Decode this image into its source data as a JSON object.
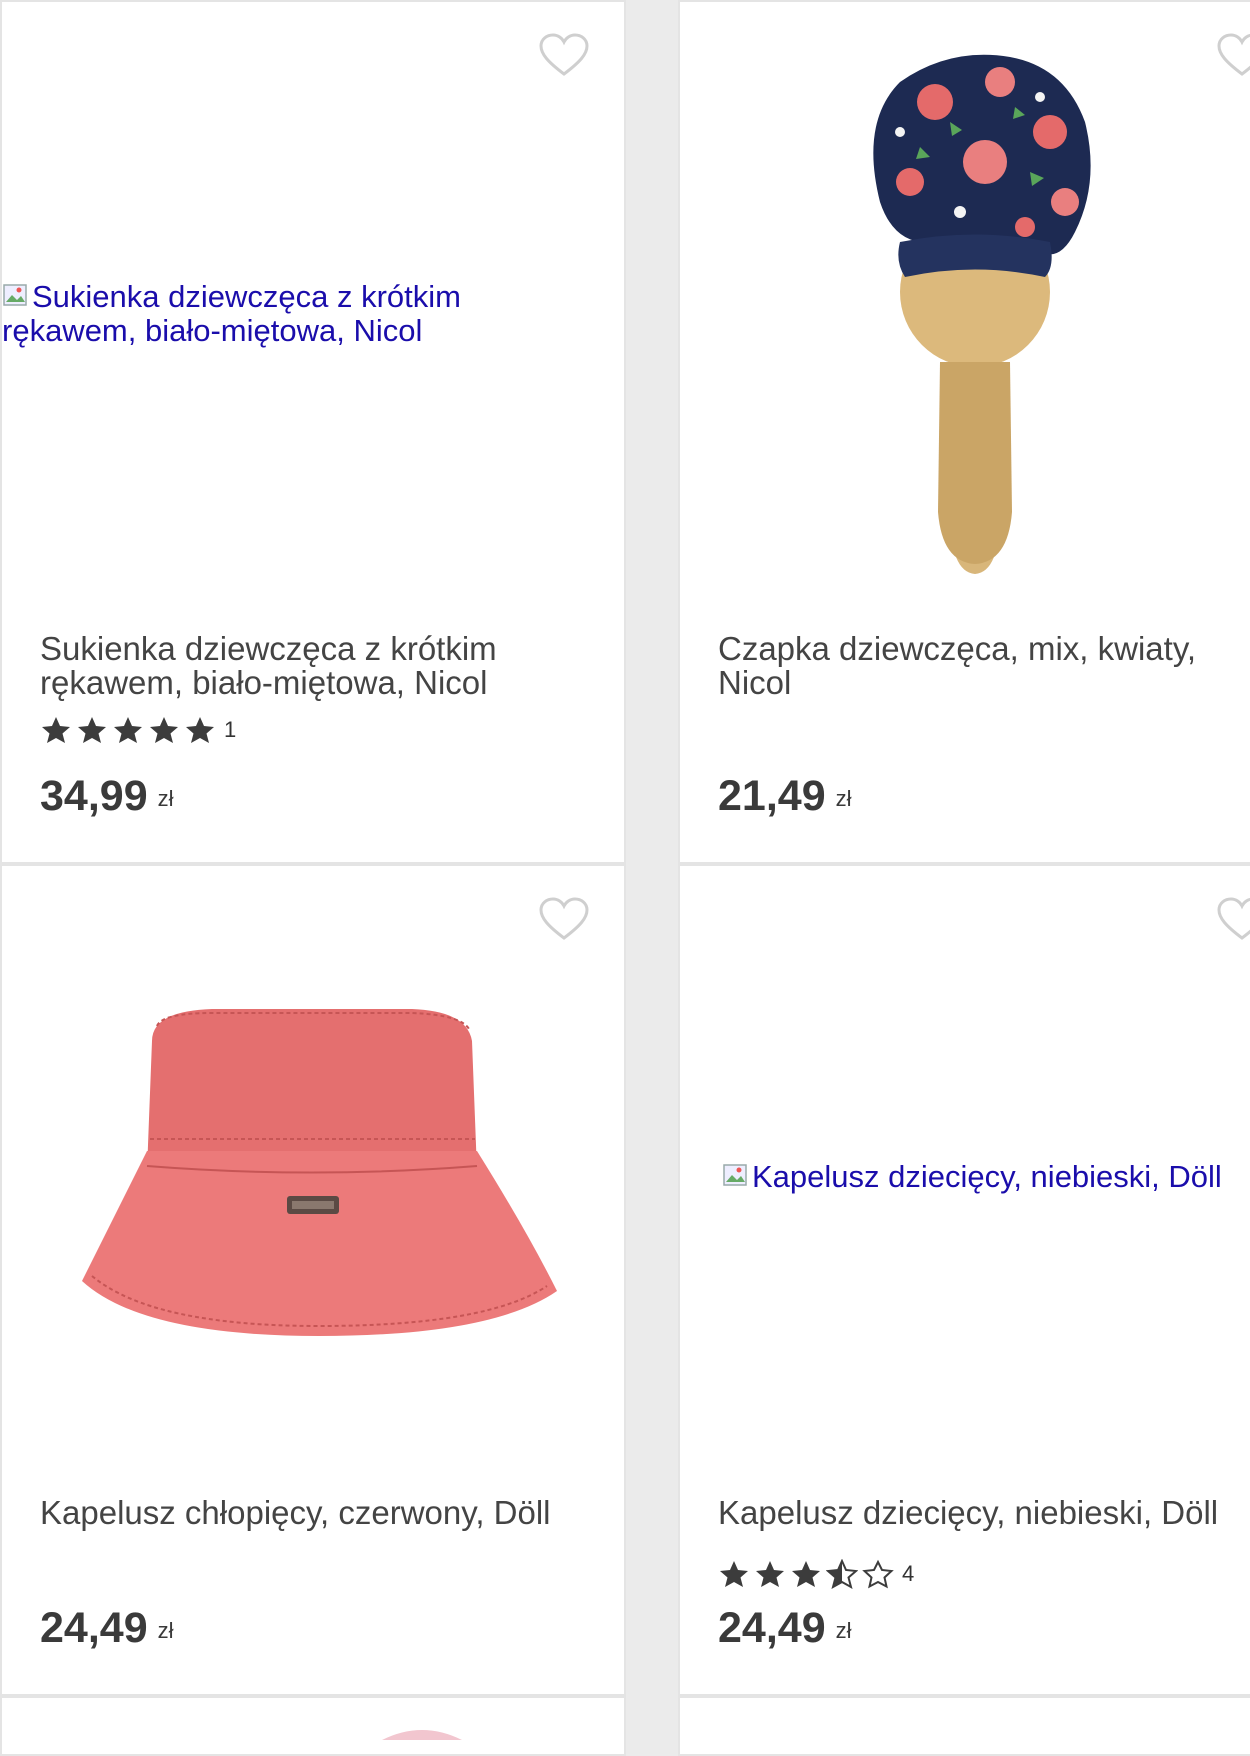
{
  "products": [
    {
      "title": "Sukienka dziewczęca z krótkim rękawem, biało-miętowa, Nicol",
      "image_alt": "Sukienka dziewczęca z krótkim rękawem, biało-miętowa, Nicol",
      "rating": 5,
      "review_count": "1",
      "price": "34,99",
      "currency": "zł"
    },
    {
      "title": "Czapka dziewczęca, mix, kwiaty, Nicol",
      "price": "21,49",
      "currency": "zł"
    },
    {
      "title": "Kapelusz chłopięcy, czerwony, Döll",
      "price": "24,49",
      "currency": "zł"
    },
    {
      "title": "Kapelusz dziecięcy, niebieski, Döll",
      "image_alt": "Kapelusz dziecięcy, niebieski, Döll",
      "rating": 3.5,
      "review_count": "4",
      "price": "24,49",
      "currency": "zł"
    }
  ],
  "colors": {
    "star": "#3c3c3c",
    "link": "#1a0dab",
    "hat_red": "#e86a6a",
    "turban_navy": "#1d2a52"
  },
  "icons": {
    "wishlist": "heart-outline-icon",
    "star_full": "star-filled-icon",
    "star_half": "star-half-icon",
    "star_empty": "star-outline-icon"
  }
}
